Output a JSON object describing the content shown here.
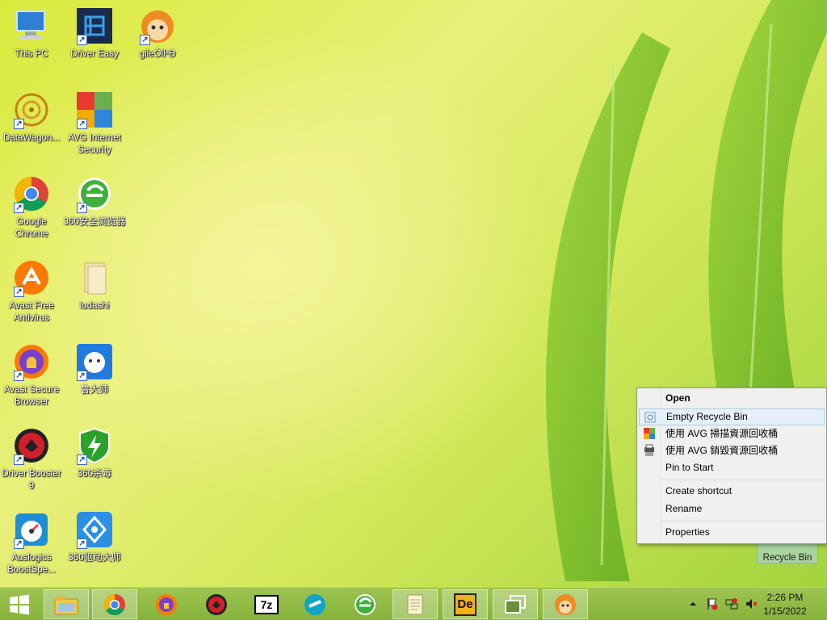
{
  "desktop": {
    "icons": [
      {
        "label": "This PC",
        "icon": "computer-icon"
      },
      {
        "label": "Driver Easy",
        "icon": "driver-easy-icon"
      },
      {
        "label": "gileÓllªÐ",
        "icon": "monkey-icon"
      },
      {
        "label": "DataWagon...",
        "icon": "mandala-icon"
      },
      {
        "label": "AVG Internet Security",
        "icon": "avg-icon"
      },
      {
        "label": "Google Chrome",
        "icon": "chrome-icon"
      },
      {
        "label": "360安全浏览器",
        "icon": "360-browser-icon"
      },
      {
        "label": "Avast Free Antivirus",
        "icon": "avast-icon"
      },
      {
        "label": "ludashi",
        "icon": "folder-icon"
      },
      {
        "label": "Avast Secure Browser",
        "icon": "avast-browser-icon"
      },
      {
        "label": "鲁大师",
        "icon": "ludashi-icon"
      },
      {
        "label": "Driver Booster 9",
        "icon": "driver-booster-icon"
      },
      {
        "label": "360杀毒",
        "icon": "360-antivirus-icon"
      },
      {
        "label": "Auslogics BoostSpe...",
        "icon": "auslogics-icon"
      },
      {
        "label": "360驱动大师",
        "icon": "360-driver-icon"
      }
    ],
    "recycle_bin_label": "Recycle Bin"
  },
  "context_menu": {
    "items": [
      {
        "label": "Open"
      },
      {
        "label": "Empty Recycle Bin"
      },
      {
        "label": "使用 AVG 掃描資源回收桶"
      },
      {
        "label": "使用 AVG 銷毀資源回收桶"
      },
      {
        "label": "Pin to Start"
      },
      {
        "label": "Create shortcut"
      },
      {
        "label": "Rename"
      },
      {
        "label": "Properties"
      }
    ]
  },
  "taskbar": {
    "clock_time": "2:26 PM",
    "clock_date": "1/15/2022",
    "buttons": [
      "windows-start-icon",
      "file-explorer-icon",
      "chrome-icon",
      "avast-browser-icon",
      "driver-booster-icon",
      "7zip-icon",
      "360-driver-icon",
      "360-browser-icon",
      "notepad-icon",
      "de-icon",
      "task-view-icon",
      "monkey-icon"
    ],
    "seven_zip_text": "7z",
    "de_text": "De"
  },
  "colors": {
    "taskbar": "#8fbc43",
    "menu_hover": "#e6f0fa"
  }
}
